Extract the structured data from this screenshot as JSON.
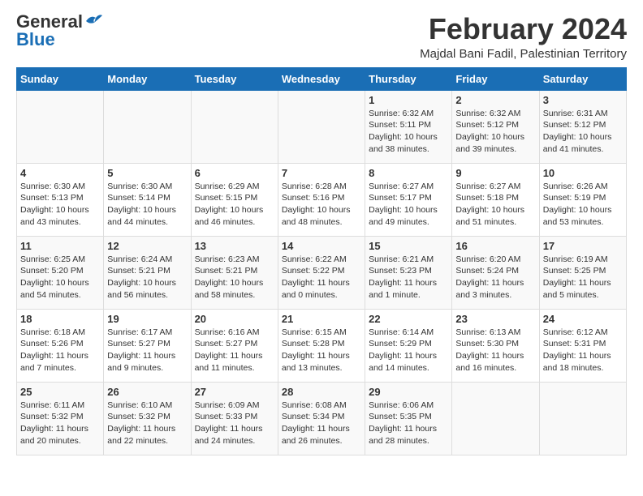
{
  "header": {
    "logo_general": "General",
    "logo_blue": "Blue",
    "month_year": "February 2024",
    "location": "Majdal Bani Fadil, Palestinian Territory"
  },
  "weekdays": [
    "Sunday",
    "Monday",
    "Tuesday",
    "Wednesday",
    "Thursday",
    "Friday",
    "Saturday"
  ],
  "weeks": [
    [
      {
        "day": "",
        "sunrise": "",
        "sunset": "",
        "daylight": ""
      },
      {
        "day": "",
        "sunrise": "",
        "sunset": "",
        "daylight": ""
      },
      {
        "day": "",
        "sunrise": "",
        "sunset": "",
        "daylight": ""
      },
      {
        "day": "",
        "sunrise": "",
        "sunset": "",
        "daylight": ""
      },
      {
        "day": "1",
        "sunrise": "Sunrise: 6:32 AM",
        "sunset": "Sunset: 5:11 PM",
        "daylight": "Daylight: 10 hours and 38 minutes."
      },
      {
        "day": "2",
        "sunrise": "Sunrise: 6:32 AM",
        "sunset": "Sunset: 5:12 PM",
        "daylight": "Daylight: 10 hours and 39 minutes."
      },
      {
        "day": "3",
        "sunrise": "Sunrise: 6:31 AM",
        "sunset": "Sunset: 5:12 PM",
        "daylight": "Daylight: 10 hours and 41 minutes."
      }
    ],
    [
      {
        "day": "4",
        "sunrise": "Sunrise: 6:30 AM",
        "sunset": "Sunset: 5:13 PM",
        "daylight": "Daylight: 10 hours and 43 minutes."
      },
      {
        "day": "5",
        "sunrise": "Sunrise: 6:30 AM",
        "sunset": "Sunset: 5:14 PM",
        "daylight": "Daylight: 10 hours and 44 minutes."
      },
      {
        "day": "6",
        "sunrise": "Sunrise: 6:29 AM",
        "sunset": "Sunset: 5:15 PM",
        "daylight": "Daylight: 10 hours and 46 minutes."
      },
      {
        "day": "7",
        "sunrise": "Sunrise: 6:28 AM",
        "sunset": "Sunset: 5:16 PM",
        "daylight": "Daylight: 10 hours and 48 minutes."
      },
      {
        "day": "8",
        "sunrise": "Sunrise: 6:27 AM",
        "sunset": "Sunset: 5:17 PM",
        "daylight": "Daylight: 10 hours and 49 minutes."
      },
      {
        "day": "9",
        "sunrise": "Sunrise: 6:27 AM",
        "sunset": "Sunset: 5:18 PM",
        "daylight": "Daylight: 10 hours and 51 minutes."
      },
      {
        "day": "10",
        "sunrise": "Sunrise: 6:26 AM",
        "sunset": "Sunset: 5:19 PM",
        "daylight": "Daylight: 10 hours and 53 minutes."
      }
    ],
    [
      {
        "day": "11",
        "sunrise": "Sunrise: 6:25 AM",
        "sunset": "Sunset: 5:20 PM",
        "daylight": "Daylight: 10 hours and 54 minutes."
      },
      {
        "day": "12",
        "sunrise": "Sunrise: 6:24 AM",
        "sunset": "Sunset: 5:21 PM",
        "daylight": "Daylight: 10 hours and 56 minutes."
      },
      {
        "day": "13",
        "sunrise": "Sunrise: 6:23 AM",
        "sunset": "Sunset: 5:21 PM",
        "daylight": "Daylight: 10 hours and 58 minutes."
      },
      {
        "day": "14",
        "sunrise": "Sunrise: 6:22 AM",
        "sunset": "Sunset: 5:22 PM",
        "daylight": "Daylight: 11 hours and 0 minutes."
      },
      {
        "day": "15",
        "sunrise": "Sunrise: 6:21 AM",
        "sunset": "Sunset: 5:23 PM",
        "daylight": "Daylight: 11 hours and 1 minute."
      },
      {
        "day": "16",
        "sunrise": "Sunrise: 6:20 AM",
        "sunset": "Sunset: 5:24 PM",
        "daylight": "Daylight: 11 hours and 3 minutes."
      },
      {
        "day": "17",
        "sunrise": "Sunrise: 6:19 AM",
        "sunset": "Sunset: 5:25 PM",
        "daylight": "Daylight: 11 hours and 5 minutes."
      }
    ],
    [
      {
        "day": "18",
        "sunrise": "Sunrise: 6:18 AM",
        "sunset": "Sunset: 5:26 PM",
        "daylight": "Daylight: 11 hours and 7 minutes."
      },
      {
        "day": "19",
        "sunrise": "Sunrise: 6:17 AM",
        "sunset": "Sunset: 5:27 PM",
        "daylight": "Daylight: 11 hours and 9 minutes."
      },
      {
        "day": "20",
        "sunrise": "Sunrise: 6:16 AM",
        "sunset": "Sunset: 5:27 PM",
        "daylight": "Daylight: 11 hours and 11 minutes."
      },
      {
        "day": "21",
        "sunrise": "Sunrise: 6:15 AM",
        "sunset": "Sunset: 5:28 PM",
        "daylight": "Daylight: 11 hours and 13 minutes."
      },
      {
        "day": "22",
        "sunrise": "Sunrise: 6:14 AM",
        "sunset": "Sunset: 5:29 PM",
        "daylight": "Daylight: 11 hours and 14 minutes."
      },
      {
        "day": "23",
        "sunrise": "Sunrise: 6:13 AM",
        "sunset": "Sunset: 5:30 PM",
        "daylight": "Daylight: 11 hours and 16 minutes."
      },
      {
        "day": "24",
        "sunrise": "Sunrise: 6:12 AM",
        "sunset": "Sunset: 5:31 PM",
        "daylight": "Daylight: 11 hours and 18 minutes."
      }
    ],
    [
      {
        "day": "25",
        "sunrise": "Sunrise: 6:11 AM",
        "sunset": "Sunset: 5:32 PM",
        "daylight": "Daylight: 11 hours and 20 minutes."
      },
      {
        "day": "26",
        "sunrise": "Sunrise: 6:10 AM",
        "sunset": "Sunset: 5:32 PM",
        "daylight": "Daylight: 11 hours and 22 minutes."
      },
      {
        "day": "27",
        "sunrise": "Sunrise: 6:09 AM",
        "sunset": "Sunset: 5:33 PM",
        "daylight": "Daylight: 11 hours and 24 minutes."
      },
      {
        "day": "28",
        "sunrise": "Sunrise: 6:08 AM",
        "sunset": "Sunset: 5:34 PM",
        "daylight": "Daylight: 11 hours and 26 minutes."
      },
      {
        "day": "29",
        "sunrise": "Sunrise: 6:06 AM",
        "sunset": "Sunset: 5:35 PM",
        "daylight": "Daylight: 11 hours and 28 minutes."
      },
      {
        "day": "",
        "sunrise": "",
        "sunset": "",
        "daylight": ""
      },
      {
        "day": "",
        "sunrise": "",
        "sunset": "",
        "daylight": ""
      }
    ]
  ]
}
